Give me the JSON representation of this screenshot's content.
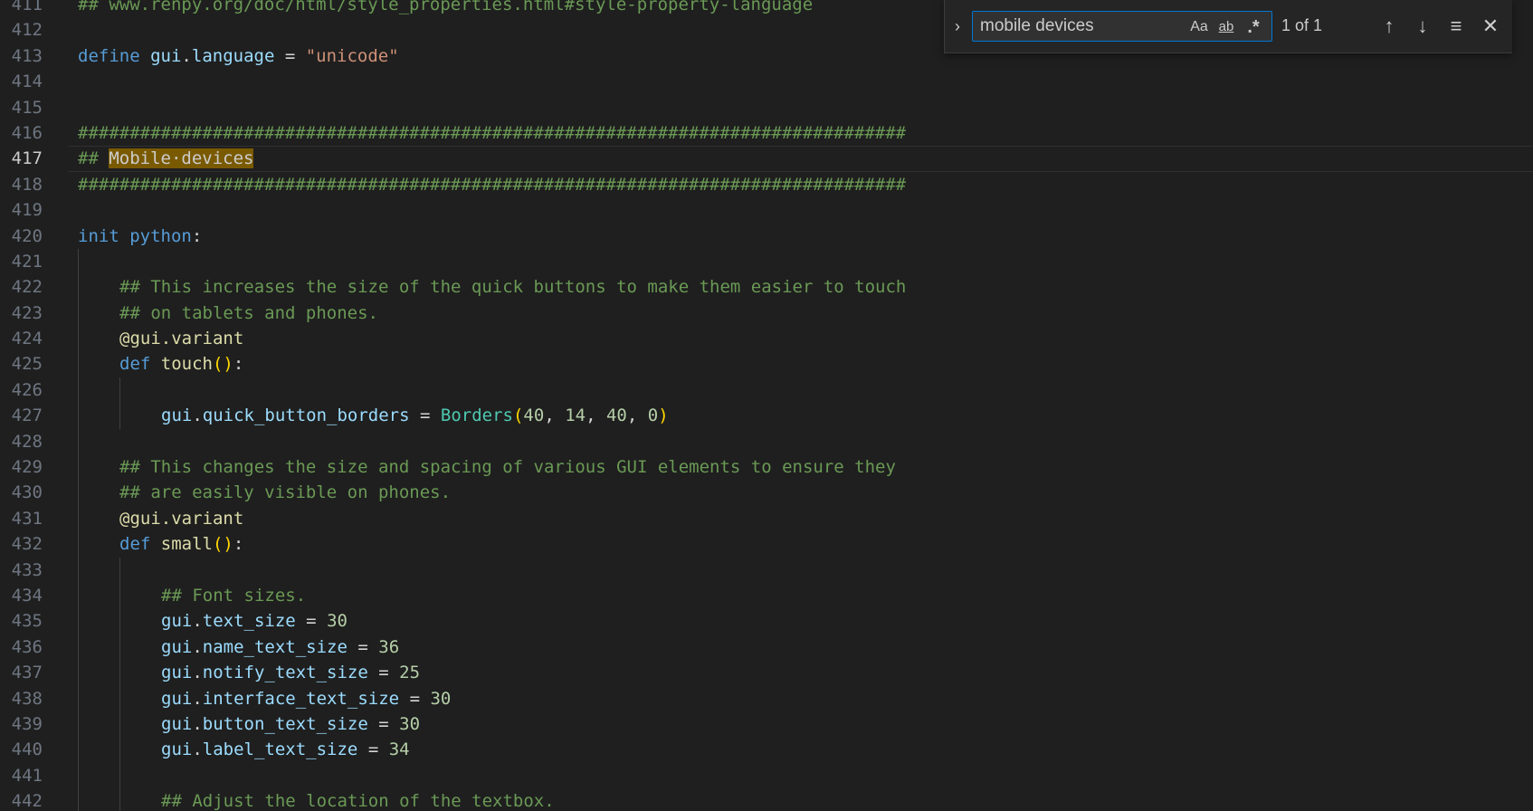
{
  "editor": {
    "lines": [
      {
        "num": "411",
        "indent": 0,
        "tokens": [
          [
            "comment",
            "## www.renpy.org/doc/html/style_properties.html#style-property-language"
          ]
        ]
      },
      {
        "num": "412",
        "indent": 0,
        "tokens": []
      },
      {
        "num": "413",
        "indent": 0,
        "tokens": [
          [
            "kw",
            "define"
          ],
          [
            "op",
            " "
          ],
          [
            "var",
            "gui"
          ],
          [
            "op",
            "."
          ],
          [
            "var",
            "language"
          ],
          [
            "op",
            " = "
          ],
          [
            "str",
            "\"unicode\""
          ]
        ]
      },
      {
        "num": "414",
        "indent": 0,
        "tokens": []
      },
      {
        "num": "415",
        "indent": 0,
        "tokens": []
      },
      {
        "num": "416",
        "indent": 0,
        "tokens": [
          [
            "comment",
            "################################################################################"
          ]
        ]
      },
      {
        "num": "417",
        "indent": 0,
        "current": true,
        "tokens": [
          [
            "comment",
            "## "
          ],
          [
            "hl",
            "Mobile·devices"
          ]
        ]
      },
      {
        "num": "418",
        "indent": 0,
        "tokens": [
          [
            "comment",
            "################################################################################"
          ]
        ]
      },
      {
        "num": "419",
        "indent": 0,
        "tokens": []
      },
      {
        "num": "420",
        "indent": 0,
        "tokens": [
          [
            "kw",
            "init"
          ],
          [
            "op",
            " "
          ],
          [
            "kw",
            "python"
          ],
          [
            "op",
            ":"
          ]
        ]
      },
      {
        "num": "421",
        "indent": 1,
        "tokens": []
      },
      {
        "num": "422",
        "indent": 1,
        "tokens": [
          [
            "comment",
            "## This increases the size of the quick buttons to make them easier to touch"
          ]
        ]
      },
      {
        "num": "423",
        "indent": 1,
        "tokens": [
          [
            "comment",
            "## on tablets and phones."
          ]
        ]
      },
      {
        "num": "424",
        "indent": 1,
        "tokens": [
          [
            "fn",
            "@gui.variant"
          ]
        ]
      },
      {
        "num": "425",
        "indent": 1,
        "tokens": [
          [
            "kw",
            "def"
          ],
          [
            "op",
            " "
          ],
          [
            "fn",
            "touch"
          ],
          [
            "br",
            "()"
          ],
          [
            "op",
            ":"
          ]
        ]
      },
      {
        "num": "426",
        "indent": 2,
        "tokens": []
      },
      {
        "num": "427",
        "indent": 2,
        "tokens": [
          [
            "var",
            "gui"
          ],
          [
            "op",
            "."
          ],
          [
            "var",
            "quick_button_borders"
          ],
          [
            "op",
            " = "
          ],
          [
            "cls",
            "Borders"
          ],
          [
            "br",
            "("
          ],
          [
            "num",
            "40"
          ],
          [
            "op",
            ", "
          ],
          [
            "num",
            "14"
          ],
          [
            "op",
            ", "
          ],
          [
            "num",
            "40"
          ],
          [
            "op",
            ", "
          ],
          [
            "num",
            "0"
          ],
          [
            "br",
            ")"
          ]
        ]
      },
      {
        "num": "428",
        "indent": 1,
        "tokens": []
      },
      {
        "num": "429",
        "indent": 1,
        "tokens": [
          [
            "comment",
            "## This changes the size and spacing of various GUI elements to ensure they"
          ]
        ]
      },
      {
        "num": "430",
        "indent": 1,
        "tokens": [
          [
            "comment",
            "## are easily visible on phones."
          ]
        ]
      },
      {
        "num": "431",
        "indent": 1,
        "tokens": [
          [
            "fn",
            "@gui.variant"
          ]
        ]
      },
      {
        "num": "432",
        "indent": 1,
        "tokens": [
          [
            "kw",
            "def"
          ],
          [
            "op",
            " "
          ],
          [
            "fn",
            "small"
          ],
          [
            "br",
            "()"
          ],
          [
            "op",
            ":"
          ]
        ]
      },
      {
        "num": "433",
        "indent": 2,
        "tokens": []
      },
      {
        "num": "434",
        "indent": 2,
        "tokens": [
          [
            "comment",
            "## Font sizes."
          ]
        ]
      },
      {
        "num": "435",
        "indent": 2,
        "tokens": [
          [
            "var",
            "gui"
          ],
          [
            "op",
            "."
          ],
          [
            "var",
            "text_size"
          ],
          [
            "op",
            " = "
          ],
          [
            "num",
            "30"
          ]
        ]
      },
      {
        "num": "436",
        "indent": 2,
        "tokens": [
          [
            "var",
            "gui"
          ],
          [
            "op",
            "."
          ],
          [
            "var",
            "name_text_size"
          ],
          [
            "op",
            " = "
          ],
          [
            "num",
            "36"
          ]
        ]
      },
      {
        "num": "437",
        "indent": 2,
        "tokens": [
          [
            "var",
            "gui"
          ],
          [
            "op",
            "."
          ],
          [
            "var",
            "notify_text_size"
          ],
          [
            "op",
            " = "
          ],
          [
            "num",
            "25"
          ]
        ]
      },
      {
        "num": "438",
        "indent": 2,
        "tokens": [
          [
            "var",
            "gui"
          ],
          [
            "op",
            "."
          ],
          [
            "var",
            "interface_text_size"
          ],
          [
            "op",
            " = "
          ],
          [
            "num",
            "30"
          ]
        ]
      },
      {
        "num": "439",
        "indent": 2,
        "tokens": [
          [
            "var",
            "gui"
          ],
          [
            "op",
            "."
          ],
          [
            "var",
            "button_text_size"
          ],
          [
            "op",
            " = "
          ],
          [
            "num",
            "30"
          ]
        ]
      },
      {
        "num": "440",
        "indent": 2,
        "tokens": [
          [
            "var",
            "gui"
          ],
          [
            "op",
            "."
          ],
          [
            "var",
            "label_text_size"
          ],
          [
            "op",
            " = "
          ],
          [
            "num",
            "34"
          ]
        ]
      },
      {
        "num": "441",
        "indent": 2,
        "tokens": []
      },
      {
        "num": "442",
        "indent": 2,
        "tokens": [
          [
            "comment",
            "## Adjust the location of the textbox."
          ]
        ]
      }
    ]
  },
  "find": {
    "query": "mobile devices",
    "match_case_label": "Aa",
    "whole_word_label": "ab",
    "regex_label": ".*",
    "match_count": "1 of 1",
    "toggle_icon": "›",
    "prev_icon": "↑",
    "next_icon": "↓",
    "selection_icon": "≡",
    "close_icon": "✕"
  }
}
